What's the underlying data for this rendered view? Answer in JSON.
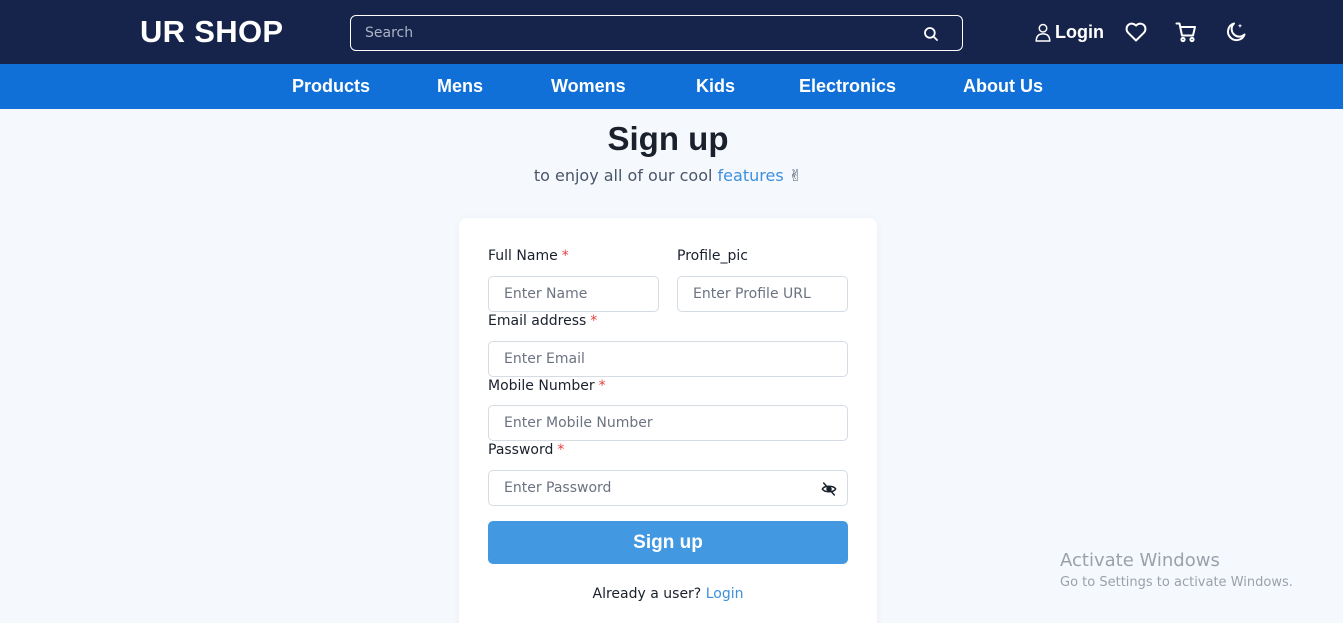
{
  "header": {
    "logo": "UR SHOP",
    "search_placeholder": "Search",
    "login_label": "Login",
    "icons": [
      "search-icon",
      "user-icon",
      "heart-icon",
      "cart-icon",
      "moon-icon"
    ]
  },
  "nav": {
    "items": [
      "Products",
      "Mens",
      "Womens",
      "Kids",
      "Electronics",
      "About Us"
    ]
  },
  "page": {
    "title": "Sign up",
    "subtitle_prefix": "to enjoy all of our cool ",
    "subtitle_accent": "features",
    "subtitle_emoji": "✌"
  },
  "form": {
    "full_name": {
      "label": "Full Name",
      "required": "*",
      "placeholder": "Enter Name"
    },
    "profile_pic": {
      "label": "Profile_pic",
      "placeholder": "Enter Profile URL"
    },
    "email": {
      "label": "Email address",
      "required": "*",
      "placeholder": "Enter Email"
    },
    "mobile": {
      "label": "Mobile Number",
      "required": "*",
      "placeholder": "Enter Mobile Number"
    },
    "password": {
      "label": "Password",
      "required": "*",
      "placeholder": "Enter Password"
    },
    "submit_label": "Sign up",
    "already_text": "Already a user? ",
    "login_link": "Login"
  },
  "watermark": {
    "title": "Activate Windows",
    "subtitle": "Go to Settings to activate Windows."
  },
  "colors": {
    "header_bg": "#16244b",
    "nav_bg": "#1170d7",
    "accent": "#4299e1",
    "required": "#e53e3e",
    "page_bg": "#f5f9fd"
  }
}
